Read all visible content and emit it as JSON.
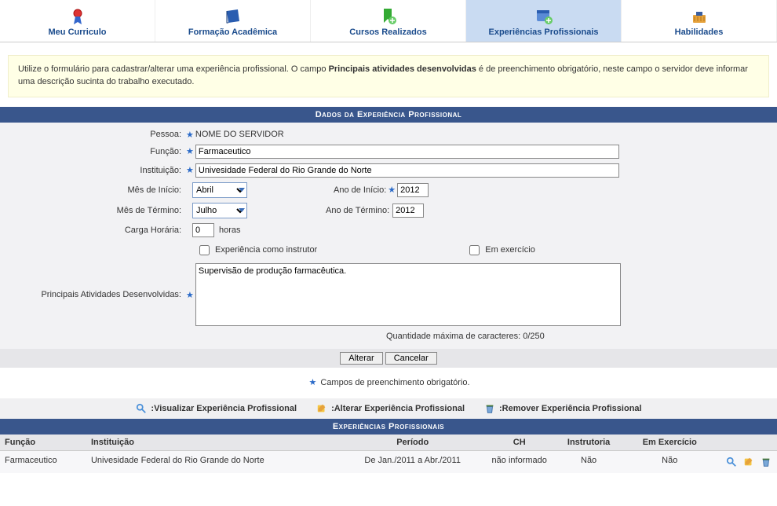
{
  "tabs": [
    {
      "label": "Meu Curriculo",
      "icon": "ribbon-icon"
    },
    {
      "label": "Formação Acadêmica",
      "icon": "book-icon"
    },
    {
      "label": "Cursos Realizados",
      "icon": "bookmark-add-icon"
    },
    {
      "label": "Experiências Profissionais",
      "icon": "calendar-add-icon",
      "active": true
    },
    {
      "label": "Habilidades",
      "icon": "tools-icon"
    }
  ],
  "info": {
    "prefix": "Utilize o formulário para cadastrar/alterar uma experiência profissional. O campo ",
    "bold": "Principais atividades desenvolvidas",
    "suffix": " é de preenchimento obrigatório, neste campo o servidor deve informar uma descrição sucinta do trabalho executado."
  },
  "section_title": "Dados da Experiência Profissional",
  "form": {
    "labels": {
      "pessoa": "Pessoa:",
      "funcao": "Função:",
      "instituicao": "Instituição:",
      "mes_inicio": "Mês de Início:",
      "ano_inicio": "Ano de Início:",
      "mes_termino": "Mês de Término:",
      "ano_termino": "Ano de Término:",
      "carga": "Carga Horária:",
      "horas": "horas",
      "chk_instrutor": "Experiência como instrutor",
      "chk_exercicio": "Em exercício",
      "principais": "Principais Atividades Desenvolvidas:"
    },
    "values": {
      "pessoa": "NOME DO SERVIDOR",
      "funcao": "Farmaceutico",
      "instituicao": "Univesidade Federal do Rio Grande do Norte",
      "mes_inicio": "Abril",
      "ano_inicio": "2012",
      "mes_termino": "Julho",
      "ano_termino": "2012",
      "carga": "0",
      "principais": "Supervisão de produção farmacêutica."
    },
    "char_count": "Quantidade máxima de caracteres: 0/250",
    "btn_alterar": "Alterar",
    "btn_cancelar": "Cancelar"
  },
  "required_note": "Campos de preenchimento obrigatório.",
  "legend": {
    "visualizar": ":Visualizar Experiência Profissional",
    "alterar": ":Alterar Experiência Profissional",
    "remover": ":Remover Experiência Profissional"
  },
  "list_title": "Experiências Profissionais",
  "table": {
    "headers": {
      "funcao": "Função",
      "instituicao": "Instituição",
      "periodo": "Período",
      "ch": "CH",
      "instrutoria": "Instrutoria",
      "exercicio": "Em Exercício"
    },
    "rows": [
      {
        "funcao": "Farmaceutico",
        "instituicao": "Univesidade Federal do Rio Grande do Norte",
        "periodo": "De Jan./2011 a Abr./2011",
        "ch": "não informado",
        "instrutoria": "Não",
        "exercicio": "Não"
      }
    ]
  }
}
